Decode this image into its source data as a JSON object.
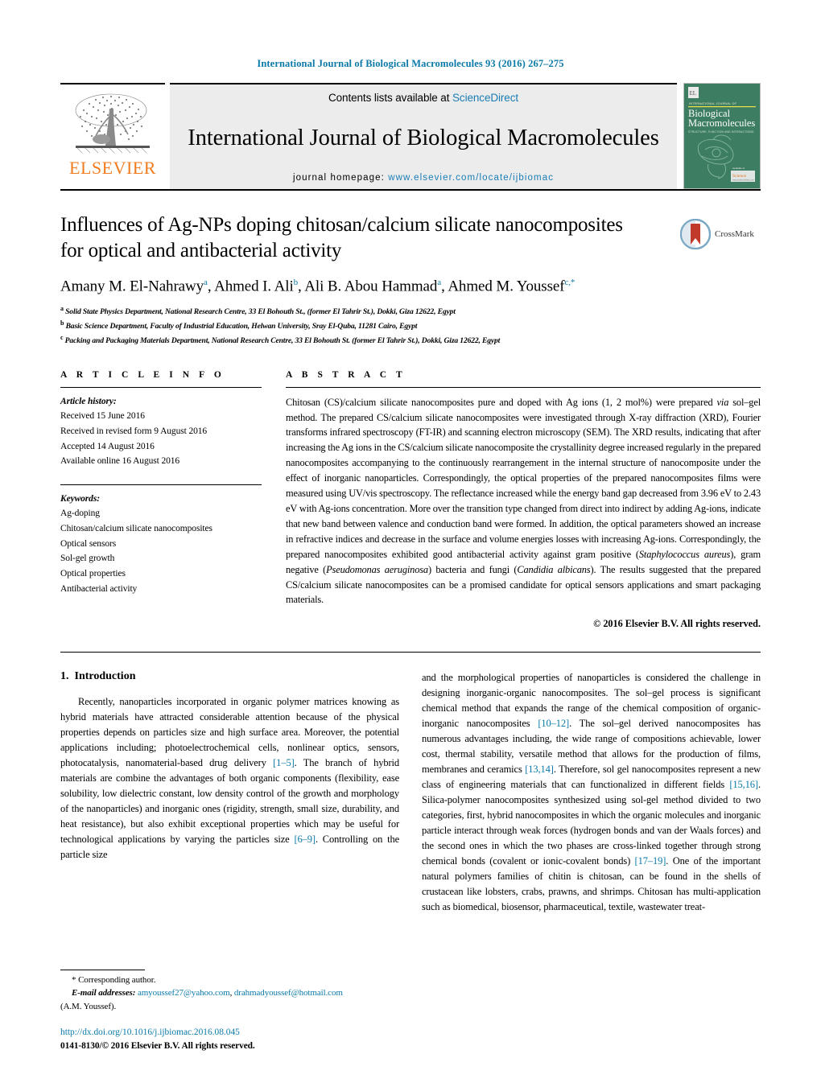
{
  "running_head": "International Journal of Biological Macromolecules 93 (2016) 267–275",
  "masthead": {
    "publisher_logo_text": "ELSEVIER",
    "contents_prefix": "Contents lists available at ",
    "contents_link": "ScienceDirect",
    "journal_title": "International Journal of Biological Macromolecules",
    "homepage_prefix": "journal homepage: ",
    "homepage_url": "www.elsevier.com/locate/ijbiomac",
    "cover_line1": "INTERNATIONAL JOURNAL OF",
    "cover_line2": "Biological",
    "cover_line3": "Macromolecules",
    "cover_line4": "STRUCTURE, FUNCTION AND INTERACTIONS",
    "cover_footer": "ScienceDirect",
    "cover_footer_sub": "www.sciencedirect.com"
  },
  "crossmark": {
    "label": "CrossMark",
    "badge_color": "#c0392b",
    "ring_color": "#5a8fb5"
  },
  "title": "Influences of Ag-NPs doping chitosan/calcium silicate nanocomposites for optical and antibacterial activity",
  "authors_html": "Amany M. El-Nahrawy<sup>a</sup>, Ahmed I. Ali<sup>b</sup>, Ali B. Abou Hammad<sup>a</sup>, Ahmed M. Youssef<sup>c,</sup><sup>*</sup>",
  "affiliations": [
    {
      "marker": "a",
      "text": "Solid State Physics Department, National Research Centre, 33 El Bohouth St., (former El Tahrir St.), Dokki, Giza 12622, Egypt"
    },
    {
      "marker": "b",
      "text": "Basic Science Department, Faculty of Industrial Education, Helwan University, Sray El-Quba, 11281 Cairo, Egypt"
    },
    {
      "marker": "c",
      "text": "Packing and Packaging Materials Department, National Research Centre, 33 El Bohouth St. (former El Tahrir St.), Dokki, Giza 12622, Egypt"
    }
  ],
  "article_info": {
    "heading": "A R T I C L E    I N F O",
    "history_label": "Article history:",
    "history": [
      "Received 15 June 2016",
      "Received in revised form 9 August 2016",
      "Accepted 14 August 2016",
      "Available online 16 August 2016"
    ],
    "keywords_label": "Keywords:",
    "keywords": [
      "Ag-doping",
      "Chitosan/calcium silicate nanocomposites",
      "Optical sensors",
      "Sol-gel growth",
      "Optical properties",
      "Antibacterial activity"
    ]
  },
  "abstract": {
    "heading": "A B S T R A C T",
    "paragraph_html": "Chitosan (CS)/calcium silicate nanocomposites pure and doped with Ag ions (1, 2 mol%) were prepared <i>via</i> sol&ndash;gel method. The prepared CS/calcium silicate nanocomposites were investigated through X-ray diffraction (XRD), Fourier transforms infrared spectroscopy (FT-IR) and scanning electron microscopy (SEM). The XRD results, indicating that after increasing the Ag ions in the CS/calcium silicate nanocomposite the crystallinity degree increased regularly in the prepared nanocomposites accompanying to the continuously rearrangement in the internal structure of nanocomposite under the effect of inorganic nanoparticles. Correspondingly, the optical properties of the prepared nanocomposites films were measured using UV/vis spectroscopy. The reflectance increased while the energy band gap decreased from 3.96 eV to 2.43 eV with Ag-ions concentration. More over the transition type changed from direct into indirect by adding Ag-ions, indicate that new band between valence and conduction band were formed. In addition, the optical parameters showed an increase in refractive indices and decrease in the surface and volume energies losses with increasing Ag-ions. Correspondingly, the prepared nanocomposites exhibited good antibacterial activity against gram positive (<i>Staphylococcus aureus</i>), gram negative (<i>Pseudomonas aeruginosa</i>) bacteria and fungi (<i>Candidia albicans</i>). The results suggested that the prepared CS/calcium silicate nanocomposites can be a promised candidate for optical sensors applications and smart packaging materials.",
    "copyright": "© 2016 Elsevier B.V. All rights reserved."
  },
  "sections": {
    "intro_number": "1.",
    "intro_title": "Introduction",
    "left_paragraph_html": "Recently, nanoparticles incorporated in organic polymer matrices knowing as hybrid materials have attracted considerable attention because of the physical properties depends on particles size and high surface area. Moreover, the potential applications including; photoelectrochemical cells, nonlinear optics, sensors, photocatalysis, nanomaterial-based drug delivery <span class=\"ref\">[1&ndash;5]</span>. The branch of hybrid materials are combine the advantages of both organic components (flexibility, ease solubility, low dielectric constant, low density control of the growth and morphology of the nanoparticles) and inorganic ones (rigidity, strength, small size, durability, and heat resistance), but also exhibit exceptional properties which may be useful for technological applications by varying the particles size <span class=\"ref\">[6&ndash;9]</span>. Controlling on the particle size",
    "right_paragraph_html": "and the morphological properties of nanoparticles is considered the challenge in designing inorganic-organic nanocomposites. The sol&ndash;gel process is significant chemical method that expands the range of the chemical composition of organic-inorganic nanocomposites <span class=\"ref\">[10&ndash;12]</span>. The sol&ndash;gel derived nanocomposites has numerous advantages including, the wide range of compositions achievable, lower cost, thermal stability, versatile method that allows for the production of films, membranes and ceramics <span class=\"ref\">[13,14]</span>. Therefore, sol gel nanocomposites represent a new class of engineering materials that can functionalized in different fields <span class=\"ref\">[15,16]</span>. Silica-polymer nanocomposites synthesized using sol-gel method divided to two categories, first, hybrid nanocomposites in which the organic molecules and inorganic particle interact through weak forces (hydrogen bonds and van der Waals forces) and the second ones in which the two phases are cross-linked together through strong chemical bonds (covalent or ionic-covalent bonds) <span class=\"ref\">[17&ndash;19]</span>. One of the important natural polymers families of chitin is chitosan, can be found in the shells of crustacean like lobsters, crabs, prawns, and shrimps. Chitosan has multi-application such as biomedical, biosensor, pharmaceutical, textile, wastewater treat-"
  },
  "footnote": {
    "star": "*",
    "corresponding": "Corresponding author.",
    "email_label": "E-mail addresses:",
    "email1": "amyoussef27@yahoo.com",
    "email_sep": ", ",
    "email2": "drahmadyoussef@hotmail.com",
    "attribution": "(A.M. Youssef)."
  },
  "doi": {
    "url": "http://dx.doi.org/10.1016/j.ijbiomac.2016.08.045",
    "issn_line": "0141-8130/© 2016 Elsevier B.V. All rights reserved."
  },
  "colors": {
    "link": "#0b7aa8",
    "elsevier_orange": "#f07c1f",
    "band_gray": "#ececec",
    "cover_green": "#3d7d62"
  }
}
